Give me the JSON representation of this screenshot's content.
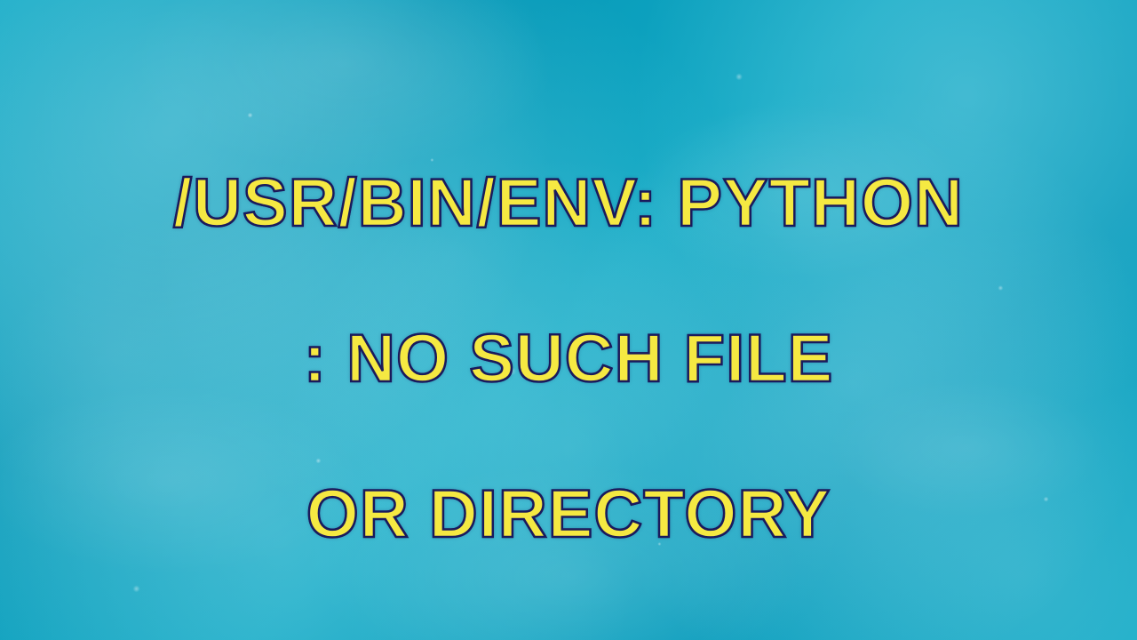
{
  "title": {
    "line1": "/USR/BIN/ENV: PYTHON",
    "line2": ": NO SUCH FILE",
    "line3": "OR DIRECTORY"
  },
  "colors": {
    "text_fill": "#f5e942",
    "text_stroke": "#1a1a5c",
    "water_base": "#0fa8c4"
  }
}
